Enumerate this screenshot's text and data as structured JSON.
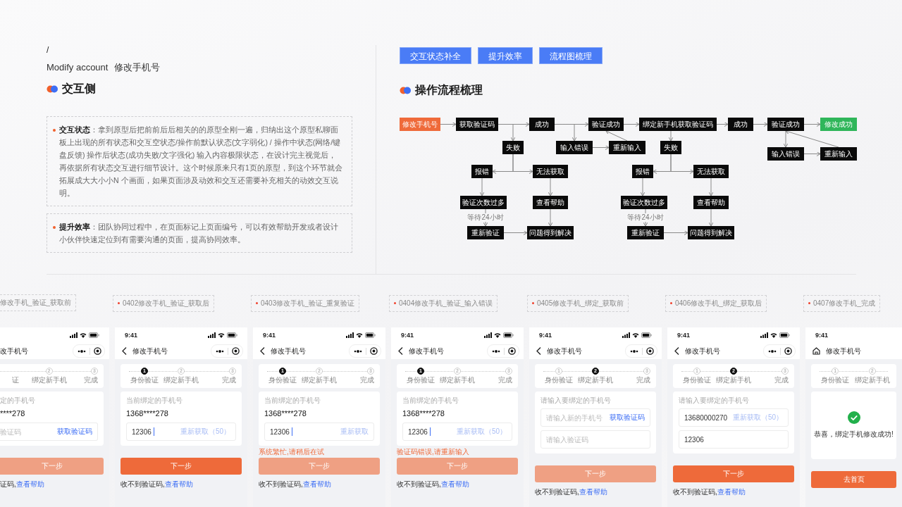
{
  "header": {
    "slash": "/",
    "title_en": "Modify account",
    "title_zh": "修改手机号"
  },
  "interaction": {
    "heading": "交互侧",
    "notes": [
      {
        "text": "**交互状态**：拿到原型后把前前后后相关的的原型全刚一遍，归纳出这个原型私聊面板上出现的所有状态和交互空状态/操作前默认状态(文字弱化) / 操作中状态(网络/键盘反馈) 操作后状态(成功失败/文字强化) 输入内容极限状态，在设计完主视觉后，再依据所有状态交互进行细节设计。这个时候原来只有1页的原型，到这个环节就会拓展成大大小小N 个画面，如果页面涉及动效和交互还需要补充相关的动效交互说明。"
      },
      {
        "text": "**提升效率**：团队协同过程中，在页面标记上页面编号，可以有效帮助开发或者设计小伙伴快速定位到有需要沟通的页面，提高协同效率。"
      }
    ]
  },
  "tags": [
    "交互状态补全",
    "提升效率",
    "流程图梳理"
  ],
  "flow": {
    "heading": "操作流程梳理",
    "nodes": [
      {
        "label": "修改手机号",
        "kind": "start"
      },
      {
        "label": "获取验证码",
        "kind": "step"
      },
      {
        "label": "成功",
        "kind": "step"
      },
      {
        "label": "验证成功",
        "kind": "step"
      },
      {
        "label": "绑定新手机获取验证码",
        "kind": "step"
      },
      {
        "label": "成功",
        "kind": "step"
      },
      {
        "label": "验证成功",
        "kind": "step"
      },
      {
        "label": "修改成功",
        "kind": "end"
      },
      {
        "label": "失败",
        "kind": "step"
      },
      {
        "label": "输入错误",
        "kind": "step"
      },
      {
        "label": "重新输入",
        "kind": "step"
      },
      {
        "label": "失败",
        "kind": "step"
      },
      {
        "label": "输入错误",
        "kind": "step"
      },
      {
        "label": "重新输入",
        "kind": "step"
      },
      {
        "label": "报错",
        "kind": "step"
      },
      {
        "label": "无法获取",
        "kind": "step"
      },
      {
        "label": "报错",
        "kind": "step"
      },
      {
        "label": "无法获取",
        "kind": "step"
      },
      {
        "label": "验证次数过多",
        "kind": "step"
      },
      {
        "label": "查看帮助",
        "kind": "step"
      },
      {
        "label": "验证次数过多",
        "kind": "step"
      },
      {
        "label": "查看帮助",
        "kind": "step"
      },
      {
        "label": "重新验证",
        "kind": "step"
      },
      {
        "label": "问题得到解决",
        "kind": "step"
      },
      {
        "label": "重新验证",
        "kind": "step"
      },
      {
        "label": "问题得到解决",
        "kind": "step"
      }
    ],
    "edge_labels": [
      "等待24小时",
      "等待24小时"
    ]
  },
  "screens": [
    {
      "label": "修改手机_验证_获取前",
      "cut_left": true,
      "status_icons": true,
      "nav": {
        "title": "改手机号"
      },
      "capsule": true,
      "steps": [
        {
          "label": "证"
        },
        {
          "number": "2",
          "label": "绑定新手机",
          "current": false
        },
        {
          "number": "3",
          "label": "完成",
          "current": false
        }
      ],
      "card": {
        "kind": "form",
        "field_label": "定的手机号",
        "value": "****278",
        "inputs": [
          {
            "placeholder": "验证码",
            "focused": false,
            "action": "获取验证码",
            "action_disabled": false
          }
        ]
      },
      "button": {
        "label": "下一步",
        "disabled": true
      },
      "footer": {
        "text": "证码,",
        "link": "查看帮助"
      }
    },
    {
      "label": "0402修改手机_验证_获取后",
      "cut_left": false,
      "time": "9:41",
      "status_icons": true,
      "nav": {
        "kind": "back",
        "title": "修改手机号"
      },
      "capsule": true,
      "steps": [
        {
          "number": "1",
          "label": "身份验证",
          "current": true
        },
        {
          "number": "2",
          "label": "绑定新手机",
          "current": false
        },
        {
          "number": "3",
          "label": "完成",
          "current": false
        }
      ],
      "card": {
        "kind": "form",
        "field_label": "当前绑定的手机号",
        "value": "1368****278",
        "inputs": [
          {
            "value": "12306",
            "focused": true,
            "action": "重新获取（50）",
            "action_disabled": true
          }
        ]
      },
      "button": {
        "label": "下一步",
        "disabled": false
      },
      "footer": {
        "text": "收不到验证码,",
        "link": "查看帮助"
      }
    },
    {
      "label": "0403修改手机_验证_重复验证",
      "cut_left": false,
      "time": "9:41",
      "status_icons": true,
      "nav": {
        "kind": "back",
        "title": "修改手机号"
      },
      "capsule": true,
      "steps": [
        {
          "number": "1",
          "label": "身份验证",
          "current": true
        },
        {
          "number": "2",
          "label": "绑定新手机",
          "current": false
        },
        {
          "number": "3",
          "label": "完成",
          "current": false
        }
      ],
      "card": {
        "kind": "form",
        "field_label": "当前绑定的手机号",
        "value": "1368****278",
        "inputs": [
          {
            "value": "12306",
            "focused": true,
            "action": "重新获取",
            "action_disabled": true
          }
        ]
      },
      "error": "系统繁忙,请稍后在试",
      "button": {
        "label": "下一步",
        "disabled": true
      },
      "footer": {
        "text": "收不到验证码,",
        "link": "查看帮助"
      }
    },
    {
      "label": "0404修改手机_验证_输入错误",
      "cut_left": false,
      "time": "9:41",
      "status_icons": true,
      "nav": {
        "kind": "back",
        "title": "修改手机号"
      },
      "capsule": true,
      "steps": [
        {
          "number": "1",
          "label": "身份验证",
          "current": true
        },
        {
          "number": "2",
          "label": "绑定新手机",
          "current": false
        },
        {
          "number": "3",
          "label": "完成",
          "current": false
        }
      ],
      "card": {
        "kind": "form",
        "field_label": "当前绑定的手机号",
        "value": "1368****278",
        "inputs": [
          {
            "value": "12306",
            "focused": true,
            "action": "重新获取（50）",
            "action_disabled": true
          }
        ]
      },
      "error": "验证码错误,请重新输入",
      "button": {
        "label": "下一步",
        "disabled": true
      },
      "footer": {
        "text": "收不到验证码,",
        "link": "查看帮助"
      }
    },
    {
      "label": "0405修改手机_绑定_获取前",
      "cut_left": false,
      "time": "9:41",
      "status_icons": true,
      "nav": {
        "kind": "back",
        "title": "修改手机号"
      },
      "capsule": true,
      "steps": [
        {
          "number": "1",
          "label": "身份验证",
          "current": false
        },
        {
          "number": "2",
          "label": "绑定新手机",
          "current": true
        },
        {
          "number": "3",
          "label": "完成",
          "current": false
        }
      ],
      "card": {
        "kind": "form",
        "field_label": "请输入要绑定的手机号",
        "inputs": [
          {
            "placeholder": "请输入新的手机号",
            "focused": false,
            "action": "获取验证码",
            "action_disabled": false
          },
          {
            "placeholder": "请输入验证码",
            "focused": false
          }
        ]
      },
      "button": {
        "label": "下一步",
        "disabled": true
      },
      "footer": {
        "text": "收不到验证码,",
        "link": "查看帮助"
      }
    },
    {
      "label": "0406修改手机_绑定_获取后",
      "cut_left": false,
      "time": "9:41",
      "status_icons": true,
      "nav": {
        "kind": "back",
        "title": "修改手机号"
      },
      "capsule": true,
      "steps": [
        {
          "number": "1",
          "label": "身份验证",
          "current": false
        },
        {
          "number": "2",
          "label": "绑定新手机",
          "current": true
        },
        {
          "number": "3",
          "label": "完成",
          "current": false
        }
      ],
      "card": {
        "kind": "form",
        "field_label": "请输入要绑定的手机号",
        "inputs": [
          {
            "value": "13680000270",
            "focused": false,
            "action": "重新获取（50）",
            "action_disabled": true
          },
          {
            "value": "12306",
            "focused": false
          }
        ]
      },
      "button": {
        "label": "下一步",
        "disabled": false
      },
      "footer": {
        "text": "收不到验证码,",
        "link": "查看帮助"
      }
    },
    {
      "label": "0407修改手机_完成",
      "cut_left": false,
      "time": "9:41",
      "status_icons": false,
      "nav": {
        "kind": "home",
        "title": "修改手机号"
      },
      "capsule": false,
      "steps": [
        {
          "number": "1",
          "label": "身份验证",
          "current": false
        },
        {
          "number": "2",
          "label": "绑定新手机",
          "current": false
        }
      ],
      "card": {
        "kind": "success",
        "message": "恭喜，绑定手机修改成功!"
      },
      "button": {
        "label": "去首页",
        "disabled": false
      }
    }
  ]
}
